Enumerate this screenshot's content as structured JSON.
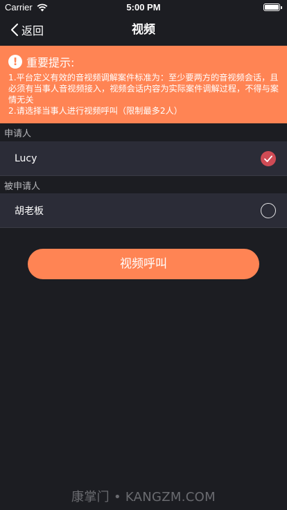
{
  "status_bar": {
    "carrier": "Carrier",
    "time": "5:00 PM"
  },
  "nav": {
    "back_label": "返回",
    "title": "视频"
  },
  "notice": {
    "icon_glyph": "!",
    "title": "重要提示:",
    "lines": [
      "1.平台定义有效的音视频调解案件标准为：至少要两方的音视频会话，且必须有当事人音视频接入，视频会话内容为实际案件调解过程，不得与案情无关",
      "2.请选择当事人进行视频呼叫（限制最多2人）"
    ]
  },
  "sections": {
    "applicant_label": "申请人",
    "respondent_label": "被申请人"
  },
  "parties": {
    "applicant": {
      "name": "Lucy",
      "selected": true
    },
    "respondent": {
      "name": "胡老板",
      "selected": false
    }
  },
  "call_button_label": "视频呼叫",
  "watermark": "康掌门 • KANGZM.COM",
  "colors": {
    "accent": "#ff8454",
    "background": "#1c1d22",
    "row": "#2b2c37",
    "check_selected": "#cf4b55"
  }
}
